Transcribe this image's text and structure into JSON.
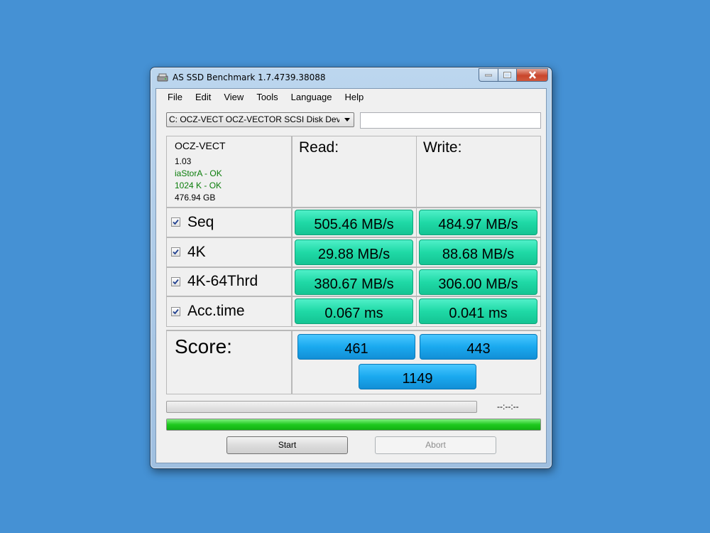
{
  "window": {
    "title": "AS SSD Benchmark 1.7.4739.38088"
  },
  "menu": [
    "File",
    "Edit",
    "View",
    "Tools",
    "Language",
    "Help"
  ],
  "drive": {
    "selected": "C: OCZ-VECT OCZ-VECTOR SCSI Disk Device"
  },
  "info": {
    "name": "OCZ-VECT",
    "firmware": "1.03",
    "driver_status": "iaStorA - OK",
    "alignment_status": "1024 K - OK",
    "size": "476.94 GB",
    "ok_color": "#0a7d0a"
  },
  "headers": {
    "read": "Read:",
    "write": "Write:"
  },
  "rows": [
    {
      "label": "Seq",
      "checked": true,
      "read": "505.46 MB/s",
      "write": "484.97 MB/s"
    },
    {
      "label": "4K",
      "checked": true,
      "read": "29.88 MB/s",
      "write": "88.68 MB/s"
    },
    {
      "label": "4K-64Thrd",
      "checked": true,
      "read": "380.67 MB/s",
      "write": "306.00 MB/s"
    },
    {
      "label": "Acc.time",
      "checked": true,
      "read": "0.067 ms",
      "write": "0.041 ms"
    }
  ],
  "score": {
    "label": "Score:",
    "read": "461",
    "write": "443",
    "total": "1149"
  },
  "progress": {
    "time_readout": "--:--:--",
    "main_fraction": 1.0
  },
  "buttons": {
    "start": "Start",
    "abort": "Abort"
  },
  "colors": {
    "result_box": "#1fd9a6",
    "score_box": "#1aa9ef",
    "progress": "#1ec91e",
    "desktop": "#4591d4"
  }
}
